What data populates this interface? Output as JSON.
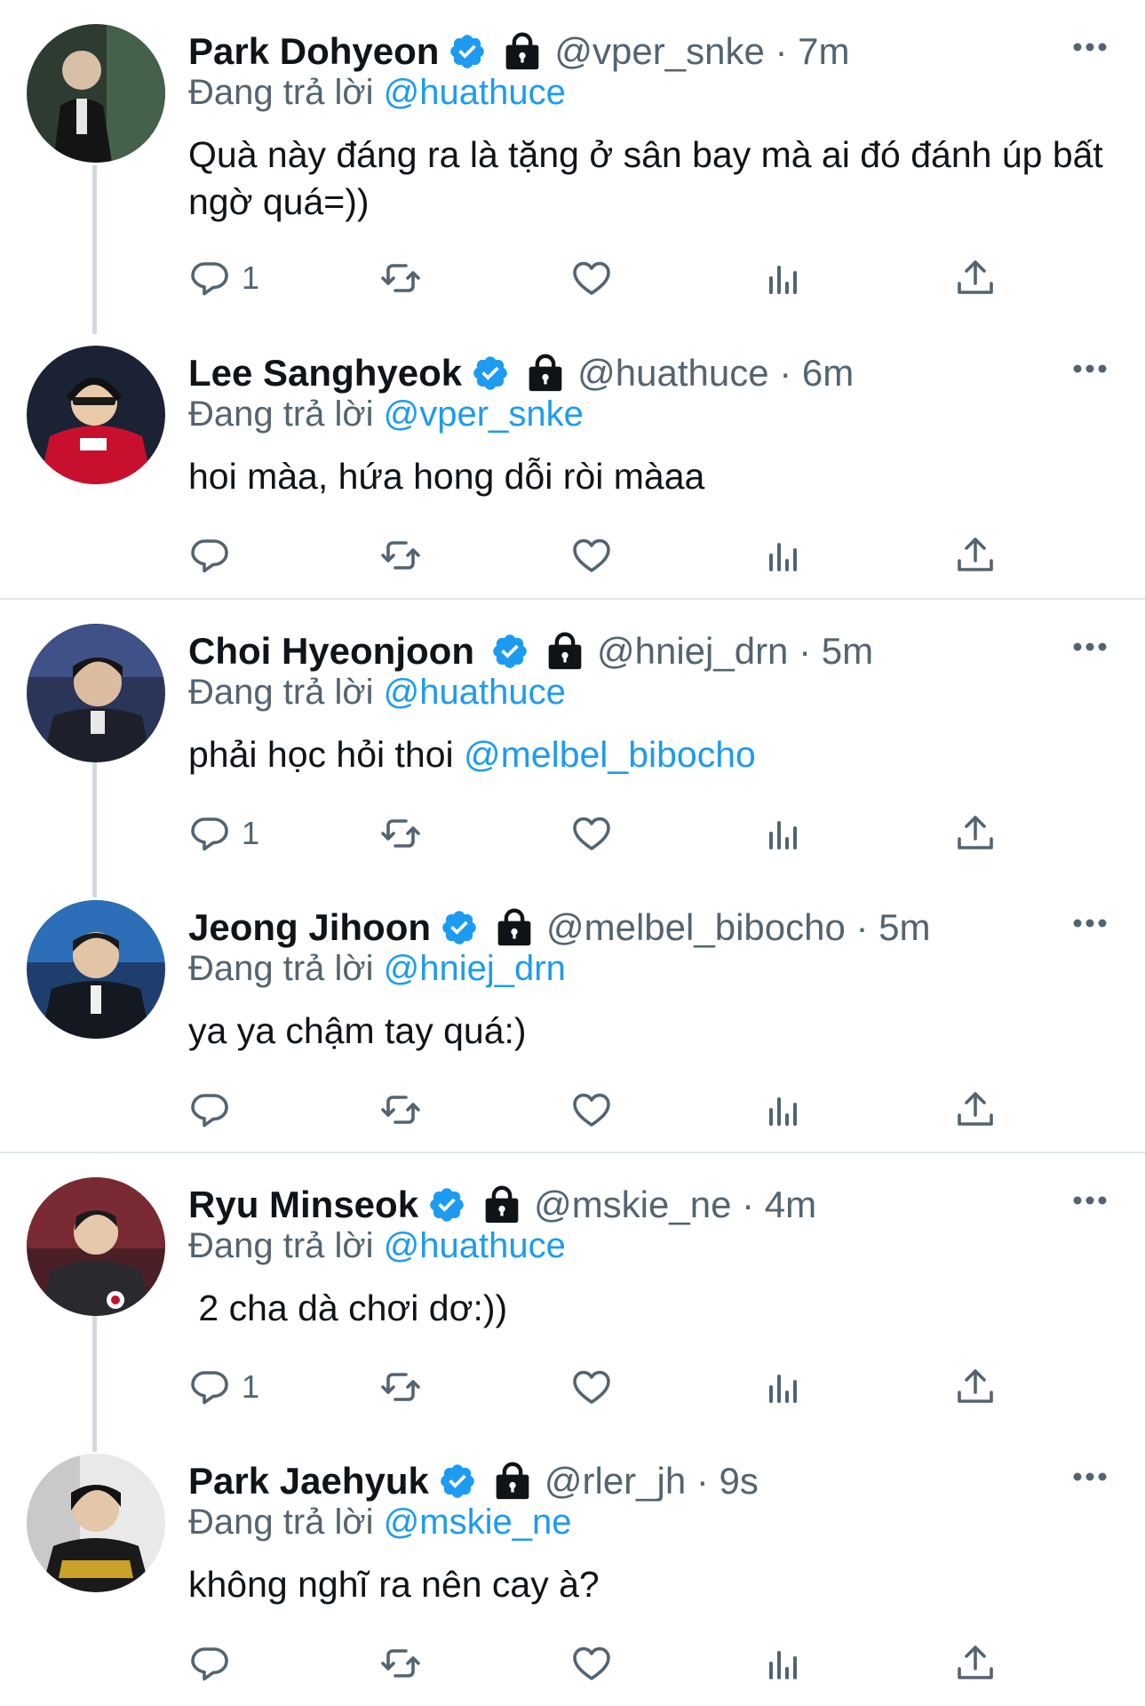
{
  "reply_prefix": "Đang trả lời",
  "tweets": [
    {
      "name": "Park Dohyeon",
      "handle": "@vper_snke",
      "time": "7m",
      "handle_time": "@vper_snke · 7m",
      "replying_to": "@huathuce",
      "text": "Quà này đáng ra là tặng ở sân bay mà ai đó đánh úp bất ngờ quá=))",
      "reply_count": "1"
    },
    {
      "name": "Lee Sanghyeok",
      "handle": "@huathuce",
      "time": "6m",
      "handle_time": "@huathuce · 6m",
      "replying_to": "@vper_snke",
      "text": "hoi màa, hứa hong dỗi ròi màaa",
      "reply_count": ""
    },
    {
      "name": "Choi Hyeonjoon",
      "handle": "@hniej_drn",
      "time": "5m",
      "handle_time": "@hniej_drn · 5m",
      "replying_to": "@huathuce",
      "text_before": "phải học hỏi thoi ",
      "text_mention": "@melbel_bibocho",
      "reply_count": "1"
    },
    {
      "name": "Jeong Jihoon",
      "handle": "@melbel_bibocho",
      "time": "5m",
      "handle_time": "@melbel_bibocho · 5m",
      "replying_to": "@hniej_drn",
      "text": "ya ya chậm tay quá:)",
      "reply_count": ""
    },
    {
      "name": "Ryu Minseok",
      "handle": "@mskie_ne",
      "time": "4m",
      "handle_time": "@mskie_ne · 4m",
      "replying_to": "@huathuce",
      "text": " 2 cha dà chơi dơ:))",
      "reply_count": "1"
    },
    {
      "name": "Park Jaehyuk",
      "handle": "@rler_jh",
      "time": "9s",
      "handle_time": "@rler_jh · 9s",
      "replying_to": "@mskie_ne",
      "text": "không nghĩ ra nên cay à?",
      "reply_count": ""
    }
  ],
  "colors": {
    "accent": "#1d9bf0",
    "muted": "#536471",
    "thread_line": "#cfd9de",
    "separator": "#e1e6ea"
  },
  "icons": [
    "reply-icon",
    "retweet-icon",
    "like-icon",
    "views-icon",
    "share-icon",
    "more-icon",
    "verified-icon",
    "lock-icon"
  ]
}
